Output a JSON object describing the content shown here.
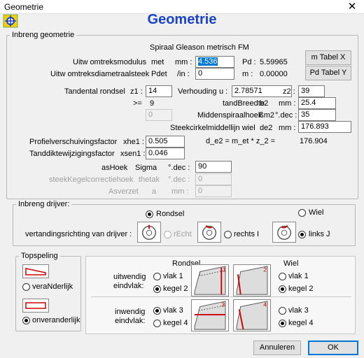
{
  "window": {
    "title": "Geometrie",
    "close_glyph": "✕"
  },
  "header": {
    "heading": "Geometrie"
  },
  "inbreng": {
    "legend": "Inbreng geometrie",
    "subtitle": "Spiraal Gleason metrisch FM",
    "modulus": {
      "label": "Uitw omtreksmodulus",
      "sym": "met",
      "unit": "mm :",
      "value": "4.536"
    },
    "pd": {
      "label": "Pd :",
      "value": "5.59965"
    },
    "diam": {
      "label": "Uitw omtreksdiametraalsteek",
      "sym": "Pdet",
      "unit": "/in :",
      "value": "0"
    },
    "m_out": {
      "label": "m :",
      "value": "0.00000"
    },
    "tabel_x": "m  Tabel X",
    "tabel_y": "Pd Tabel Y",
    "z1": {
      "label": "Tandental rondsel",
      "sym": "z1 :",
      "value": "14"
    },
    "verhouding": {
      "label": "Verhouding",
      "sym": "u :",
      "value": "2.78571"
    },
    "z2": {
      "label": "z2 :",
      "value": "39"
    },
    "ge": {
      "label": ">=",
      "value": "9"
    },
    "z1_min": {
      "value": "0"
    },
    "b2": {
      "label": "tandBreedte",
      "sym": "b2",
      "unit": "mm :",
      "value": "25.4"
    },
    "beta": {
      "label": "Middenspiraalhoek",
      "sym": "ßm2",
      "unit": "°.dec :",
      "value": "35"
    },
    "de2": {
      "label": "Steekcirkelmiddellijn wiel",
      "sym": "de2",
      "unit": "mm :",
      "value": "176.893"
    },
    "xhe1": {
      "label": "Profielverschuivingsfactor",
      "sym": "xhe1 :",
      "value": "0.505"
    },
    "de2_eq": {
      "text": "d_e2 = m_et * z_2 =",
      "value": "176.904"
    },
    "xsen1": {
      "label": "Tanddiktewijzigingsfactor",
      "sym": "xsen1 :",
      "value": "0.046"
    },
    "sigma": {
      "label": "asHoek",
      "sym": "Sigma",
      "unit": "°.dec :",
      "value": "90"
    },
    "thetak": {
      "label": "steekKegelcorrectiehoek",
      "sym": "thetak",
      "unit": "°.dec :",
      "value": "0"
    },
    "a": {
      "label": "Asverzet",
      "sym": "a",
      "unit": "mm :",
      "value": "0"
    }
  },
  "drijver": {
    "legend": "Inbreng drijver:",
    "rondsel": "Rondsel",
    "wiel": "Wiel",
    "richting_label": "vertandingsrichting van drijver :",
    "recht": "rEcht",
    "rechts": "rechts I",
    "links": "links  J"
  },
  "topspeling": {
    "legend": "Topspeling",
    "veranderlijk": "veraNderlijk",
    "onveranderlijk": "onveranderlijk"
  },
  "eindvlak": {
    "rondsel_header": "Rondsel",
    "wiel_header": "Wiel",
    "uitwendig": "uitwendig\neindvlak:",
    "inwendig": "inwendig\neindvlak:",
    "vlak1": "vlak  1",
    "kegel2": "kegel 2",
    "vlak3": "vlak  3",
    "kegel4": "kegel 4",
    "gear_nums": [
      "1",
      "2",
      "3",
      "4"
    ]
  },
  "footer": {
    "annuleren": "Annuleren",
    "ok": "OK"
  },
  "colors": {
    "accent": "#1a43c8",
    "selection": "#0078d7",
    "gear_red": "#d00000"
  }
}
